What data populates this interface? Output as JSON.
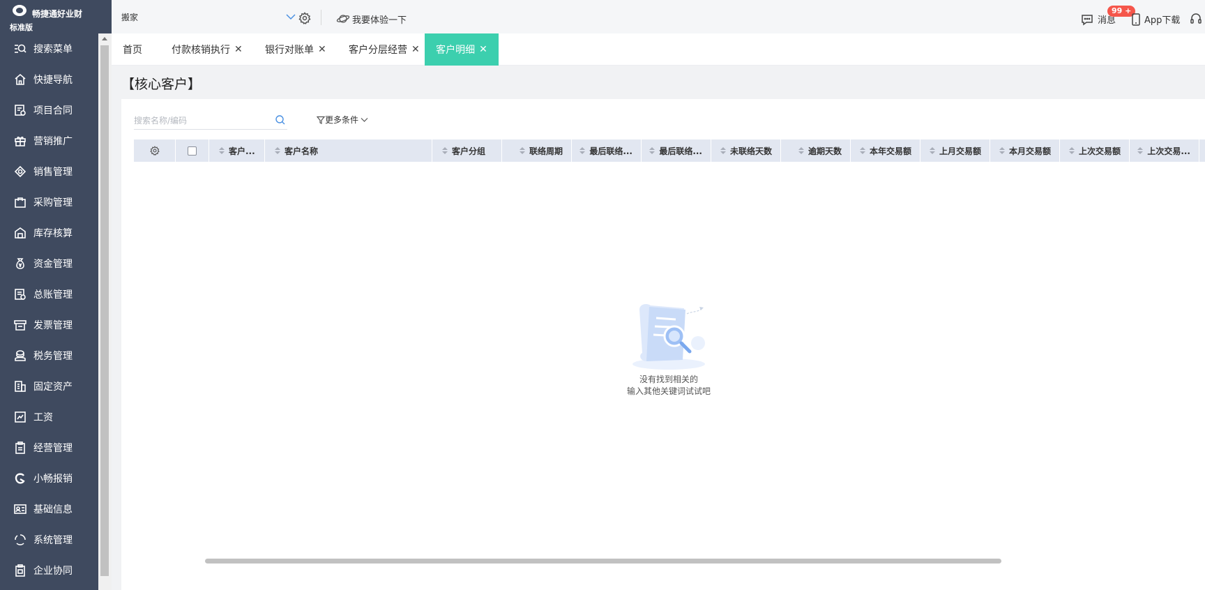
{
  "app": {
    "name": "畅捷通好业财",
    "edition": "标准版"
  },
  "sidebar": {
    "items": [
      {
        "label": "搜索菜单",
        "icon": "search-menu-icon"
      },
      {
        "label": "快捷导航",
        "icon": "home-icon"
      },
      {
        "label": "项目合同",
        "icon": "contract-icon"
      },
      {
        "label": "营销推广",
        "icon": "gift-icon"
      },
      {
        "label": "销售管理",
        "icon": "sales-icon"
      },
      {
        "label": "采购管理",
        "icon": "shopping-bag-icon"
      },
      {
        "label": "库存核算",
        "icon": "warehouse-icon"
      },
      {
        "label": "资金管理",
        "icon": "money-bag-icon"
      },
      {
        "label": "总账管理",
        "icon": "ledger-icon"
      },
      {
        "label": "发票管理",
        "icon": "invoice-icon"
      },
      {
        "label": "税务管理",
        "icon": "tax-icon"
      },
      {
        "label": "固定资产",
        "icon": "building-icon"
      },
      {
        "label": "工资",
        "icon": "salary-icon"
      },
      {
        "label": "经营管理",
        "icon": "clipboard-icon"
      },
      {
        "label": "小畅报销",
        "icon": "reimburse-icon"
      },
      {
        "label": "基础信息",
        "icon": "id-card-icon"
      },
      {
        "label": "系统管理",
        "icon": "system-icon"
      },
      {
        "label": "企业协同",
        "icon": "collab-icon"
      }
    ]
  },
  "topbar": {
    "search_select_value": "搬家",
    "try_label": "我要体验一下",
    "messages_label": "消息",
    "messages_badge": "99 +",
    "app_download_label": "App下载"
  },
  "tabs": [
    {
      "label": "首页",
      "closable": false,
      "active": false
    },
    {
      "label": "付款核销执行",
      "closable": true,
      "active": false
    },
    {
      "label": "银行对账单",
      "closable": true,
      "active": false
    },
    {
      "label": "客户分层经营",
      "closable": true,
      "active": false
    },
    {
      "label": "客户明细",
      "closable": true,
      "active": true
    }
  ],
  "page": {
    "title": "【核心客户】",
    "search_placeholder": "搜索名称/编码",
    "more_filter_label": "更多条件"
  },
  "table": {
    "columns": [
      {
        "label": "客户..."
      },
      {
        "label": "客户名称"
      },
      {
        "label": "客户分组"
      },
      {
        "label": "联络周期"
      },
      {
        "label": "最后联络..."
      },
      {
        "label": "最后联络..."
      },
      {
        "label": "未联络天数"
      },
      {
        "label": "逾期天数"
      },
      {
        "label": "本年交易额"
      },
      {
        "label": "上月交易额"
      },
      {
        "label": "本月交易额"
      },
      {
        "label": "上次交易额"
      },
      {
        "label": "上次交易..."
      }
    ],
    "rows": []
  },
  "empty_state": {
    "line1": "没有找到相关的",
    "line2": "输入其他关键词试试吧"
  },
  "colors": {
    "sidebar_bg": "#3f4a5f",
    "active_tab": "#3ccfae",
    "badge": "#f5564b",
    "table_header": "#e2e7f1"
  }
}
